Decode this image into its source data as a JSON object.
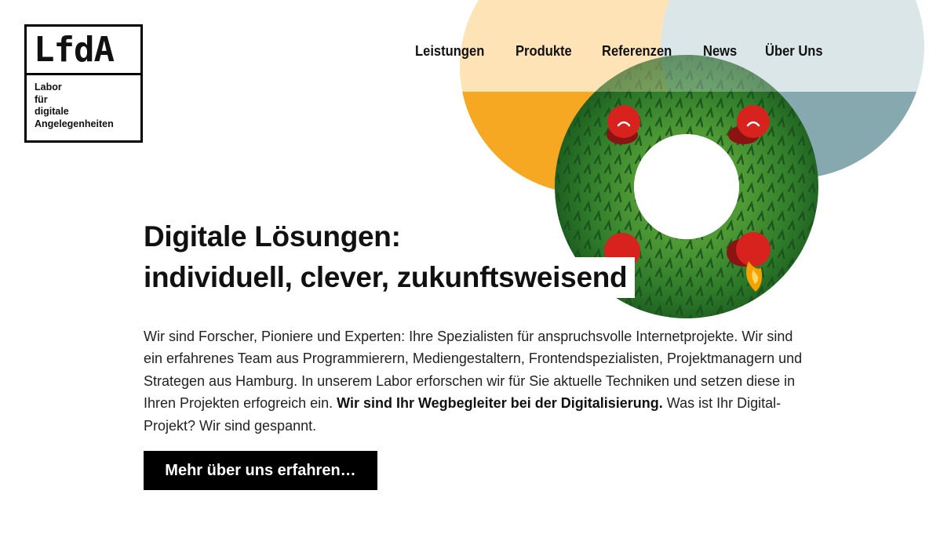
{
  "logo": {
    "mark": "LfdA",
    "lines": [
      "Labor",
      "für",
      "digitale",
      "Angelegenheiten"
    ]
  },
  "nav": {
    "items": [
      "Leistungen",
      "Produkte",
      "Referenzen",
      "News",
      "Über Uns"
    ]
  },
  "hero": {
    "headline_line1": "Digitale Lösungen:",
    "headline_line2": "individuell, clever, zukunftsweisend",
    "intro_part1": "Wir sind Forscher, Pioniere und Experten: Ihre Spezialisten für anspruchsvolle Internetprojekte. Wir sind ein erfahrenes Team aus Programmierern, Mediengestaltern, Frontendspezialisten, Projektmanagern und Strategen aus Hamburg. In unserem Labor erforschen wir für Sie aktuelle Techniken und setzen diese in Ihren Projekten erfogreich ein.",
    "intro_bold": "Wir sind Ihr Wegbegleiter bei der Digitalisierung.",
    "intro_part2": "Was ist Ihr Digital-Projekt? Wir sind gespannt.",
    "cta_label": "Mehr über uns erfahren…"
  },
  "colors": {
    "orange": "#f7a823",
    "orange_light": "#fde3b6",
    "blue_grey": "#85a9af",
    "blue_grey_light": "#dbe6e8",
    "wreath_green": "#2f7a2c",
    "candle_red": "#d8221e",
    "flame": "#f5a200"
  }
}
